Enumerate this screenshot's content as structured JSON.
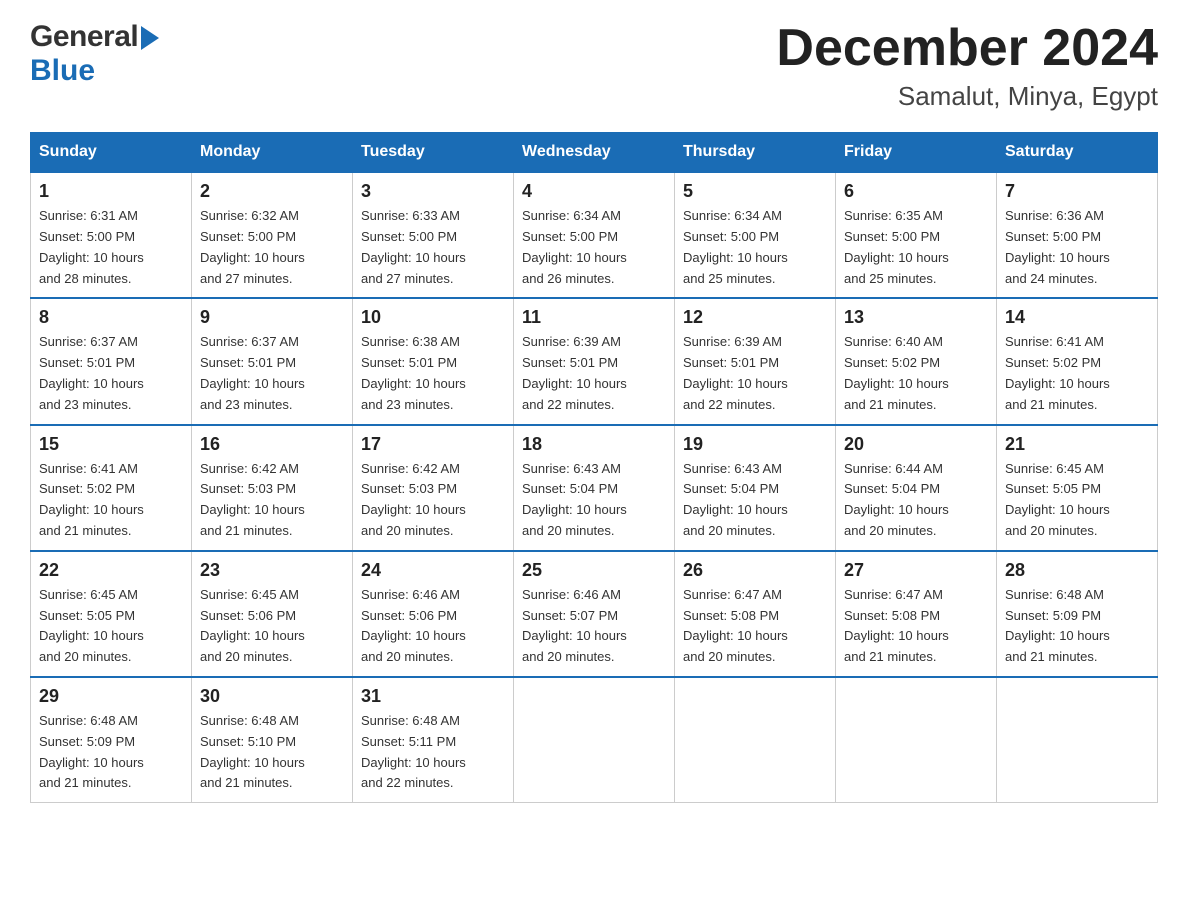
{
  "header": {
    "title": "December 2024",
    "subtitle": "Samalut, Minya, Egypt"
  },
  "logo": {
    "general": "General",
    "blue": "Blue"
  },
  "days_of_week": [
    "Sunday",
    "Monday",
    "Tuesday",
    "Wednesday",
    "Thursday",
    "Friday",
    "Saturday"
  ],
  "weeks": [
    [
      {
        "day": "1",
        "sunrise": "6:31 AM",
        "sunset": "5:00 PM",
        "daylight": "10 hours and 28 minutes."
      },
      {
        "day": "2",
        "sunrise": "6:32 AM",
        "sunset": "5:00 PM",
        "daylight": "10 hours and 27 minutes."
      },
      {
        "day": "3",
        "sunrise": "6:33 AM",
        "sunset": "5:00 PM",
        "daylight": "10 hours and 27 minutes."
      },
      {
        "day": "4",
        "sunrise": "6:34 AM",
        "sunset": "5:00 PM",
        "daylight": "10 hours and 26 minutes."
      },
      {
        "day": "5",
        "sunrise": "6:34 AM",
        "sunset": "5:00 PM",
        "daylight": "10 hours and 25 minutes."
      },
      {
        "day": "6",
        "sunrise": "6:35 AM",
        "sunset": "5:00 PM",
        "daylight": "10 hours and 25 minutes."
      },
      {
        "day": "7",
        "sunrise": "6:36 AM",
        "sunset": "5:00 PM",
        "daylight": "10 hours and 24 minutes."
      }
    ],
    [
      {
        "day": "8",
        "sunrise": "6:37 AM",
        "sunset": "5:01 PM",
        "daylight": "10 hours and 23 minutes."
      },
      {
        "day": "9",
        "sunrise": "6:37 AM",
        "sunset": "5:01 PM",
        "daylight": "10 hours and 23 minutes."
      },
      {
        "day": "10",
        "sunrise": "6:38 AM",
        "sunset": "5:01 PM",
        "daylight": "10 hours and 23 minutes."
      },
      {
        "day": "11",
        "sunrise": "6:39 AM",
        "sunset": "5:01 PM",
        "daylight": "10 hours and 22 minutes."
      },
      {
        "day": "12",
        "sunrise": "6:39 AM",
        "sunset": "5:01 PM",
        "daylight": "10 hours and 22 minutes."
      },
      {
        "day": "13",
        "sunrise": "6:40 AM",
        "sunset": "5:02 PM",
        "daylight": "10 hours and 21 minutes."
      },
      {
        "day": "14",
        "sunrise": "6:41 AM",
        "sunset": "5:02 PM",
        "daylight": "10 hours and 21 minutes."
      }
    ],
    [
      {
        "day": "15",
        "sunrise": "6:41 AM",
        "sunset": "5:02 PM",
        "daylight": "10 hours and 21 minutes."
      },
      {
        "day": "16",
        "sunrise": "6:42 AM",
        "sunset": "5:03 PM",
        "daylight": "10 hours and 21 minutes."
      },
      {
        "day": "17",
        "sunrise": "6:42 AM",
        "sunset": "5:03 PM",
        "daylight": "10 hours and 20 minutes."
      },
      {
        "day": "18",
        "sunrise": "6:43 AM",
        "sunset": "5:04 PM",
        "daylight": "10 hours and 20 minutes."
      },
      {
        "day": "19",
        "sunrise": "6:43 AM",
        "sunset": "5:04 PM",
        "daylight": "10 hours and 20 minutes."
      },
      {
        "day": "20",
        "sunrise": "6:44 AM",
        "sunset": "5:04 PM",
        "daylight": "10 hours and 20 minutes."
      },
      {
        "day": "21",
        "sunrise": "6:45 AM",
        "sunset": "5:05 PM",
        "daylight": "10 hours and 20 minutes."
      }
    ],
    [
      {
        "day": "22",
        "sunrise": "6:45 AM",
        "sunset": "5:05 PM",
        "daylight": "10 hours and 20 minutes."
      },
      {
        "day": "23",
        "sunrise": "6:45 AM",
        "sunset": "5:06 PM",
        "daylight": "10 hours and 20 minutes."
      },
      {
        "day": "24",
        "sunrise": "6:46 AM",
        "sunset": "5:06 PM",
        "daylight": "10 hours and 20 minutes."
      },
      {
        "day": "25",
        "sunrise": "6:46 AM",
        "sunset": "5:07 PM",
        "daylight": "10 hours and 20 minutes."
      },
      {
        "day": "26",
        "sunrise": "6:47 AM",
        "sunset": "5:08 PM",
        "daylight": "10 hours and 20 minutes."
      },
      {
        "day": "27",
        "sunrise": "6:47 AM",
        "sunset": "5:08 PM",
        "daylight": "10 hours and 21 minutes."
      },
      {
        "day": "28",
        "sunrise": "6:48 AM",
        "sunset": "5:09 PM",
        "daylight": "10 hours and 21 minutes."
      }
    ],
    [
      {
        "day": "29",
        "sunrise": "6:48 AM",
        "sunset": "5:09 PM",
        "daylight": "10 hours and 21 minutes."
      },
      {
        "day": "30",
        "sunrise": "6:48 AM",
        "sunset": "5:10 PM",
        "daylight": "10 hours and 21 minutes."
      },
      {
        "day": "31",
        "sunrise": "6:48 AM",
        "sunset": "5:11 PM",
        "daylight": "10 hours and 22 minutes."
      },
      null,
      null,
      null,
      null
    ]
  ],
  "labels": {
    "sunrise": "Sunrise:",
    "sunset": "Sunset:",
    "daylight": "Daylight:"
  }
}
